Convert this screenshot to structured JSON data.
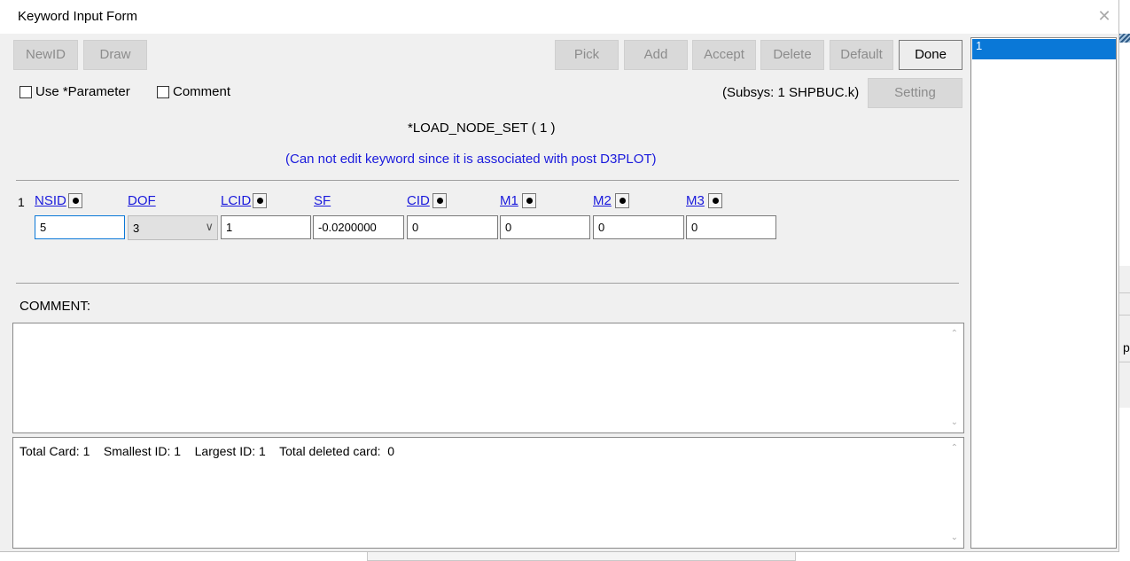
{
  "window": {
    "title": "Keyword Input Form",
    "close_glyph": "✕"
  },
  "toolbar": {
    "newid": "NewID",
    "draw": "Draw",
    "pick": "Pick",
    "add": "Add",
    "accept": "Accept",
    "delete": "Delete",
    "default": "Default",
    "done": "Done",
    "setting": "Setting"
  },
  "options": {
    "use_parameter": "Use *Parameter",
    "comment": "Comment",
    "subsys": "(Subsys: 1 SHPBUC.k)"
  },
  "keyword": {
    "title": "*LOAD_NODE_SET    ( 1 )",
    "warning": "(Can not edit keyword since it is associated with post D3PLOT)"
  },
  "card": {
    "row_number": "1",
    "fields": [
      {
        "label": "NSID",
        "value": "5",
        "has_dot": true
      },
      {
        "label": "DOF",
        "value": "3",
        "has_dot": false,
        "type": "select"
      },
      {
        "label": "LCID",
        "value": "1",
        "has_dot": true
      },
      {
        "label": "SF",
        "value": "-0.0200000",
        "has_dot": false
      },
      {
        "label": "CID",
        "value": "0",
        "has_dot": true
      },
      {
        "label": "M1",
        "value": "0",
        "has_dot": true
      },
      {
        "label": "M2",
        "value": "0",
        "has_dot": true
      },
      {
        "label": "M3",
        "value": "0",
        "has_dot": true
      }
    ]
  },
  "comment_section": {
    "label": "COMMENT:",
    "text": ""
  },
  "stats": {
    "text": "Total Card: 1    Smallest ID: 1    Largest ID: 1    Total deleted card:  0"
  },
  "id_list": {
    "items": [
      "1"
    ],
    "selected": "1"
  },
  "background": {
    "partial_text": "p"
  },
  "icons": {
    "scroll_up": "up-arrow-icon",
    "scroll_down": "down-arrow-icon",
    "dropdown": "chevron-down-icon"
  }
}
